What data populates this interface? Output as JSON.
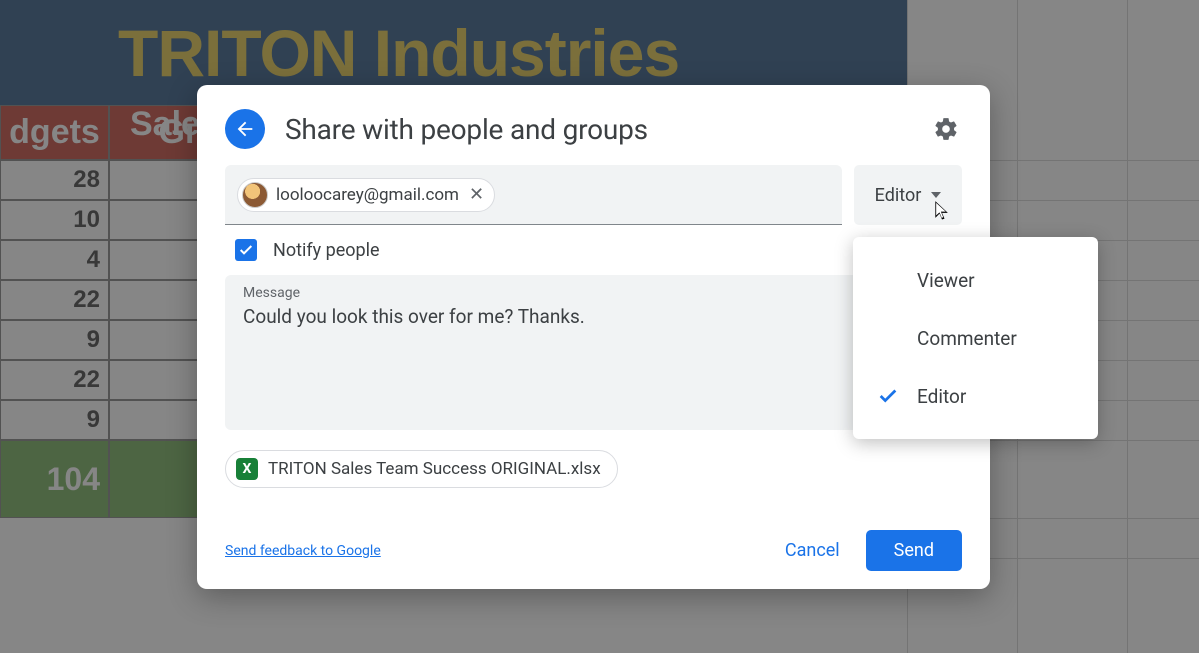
{
  "background": {
    "company_title": "TRITON Industries",
    "header_col1": "dgets",
    "header_col2": "Gi",
    "sales_label_fragment": "Sale",
    "rows": [
      "28",
      "10",
      "4",
      "22",
      "9",
      "22",
      "9"
    ],
    "sum": "104"
  },
  "modal": {
    "title": "Share with people and groups",
    "recipient_email": "looloocarey@gmail.com",
    "role_button": "Editor",
    "notify_label": "Notify people",
    "notify_checked": true,
    "message_label": "Message",
    "message_text": "Could you look this over for me? Thanks.",
    "attachment_name": "TRITON Sales Team Success ORIGINAL.xlsx",
    "feedback_link": "Send feedback to Google",
    "cancel_label": "Cancel",
    "send_label": "Send"
  },
  "role_menu": {
    "options": [
      {
        "label": "Viewer",
        "selected": false
      },
      {
        "label": "Commenter",
        "selected": false
      },
      {
        "label": "Editor",
        "selected": true
      }
    ]
  }
}
